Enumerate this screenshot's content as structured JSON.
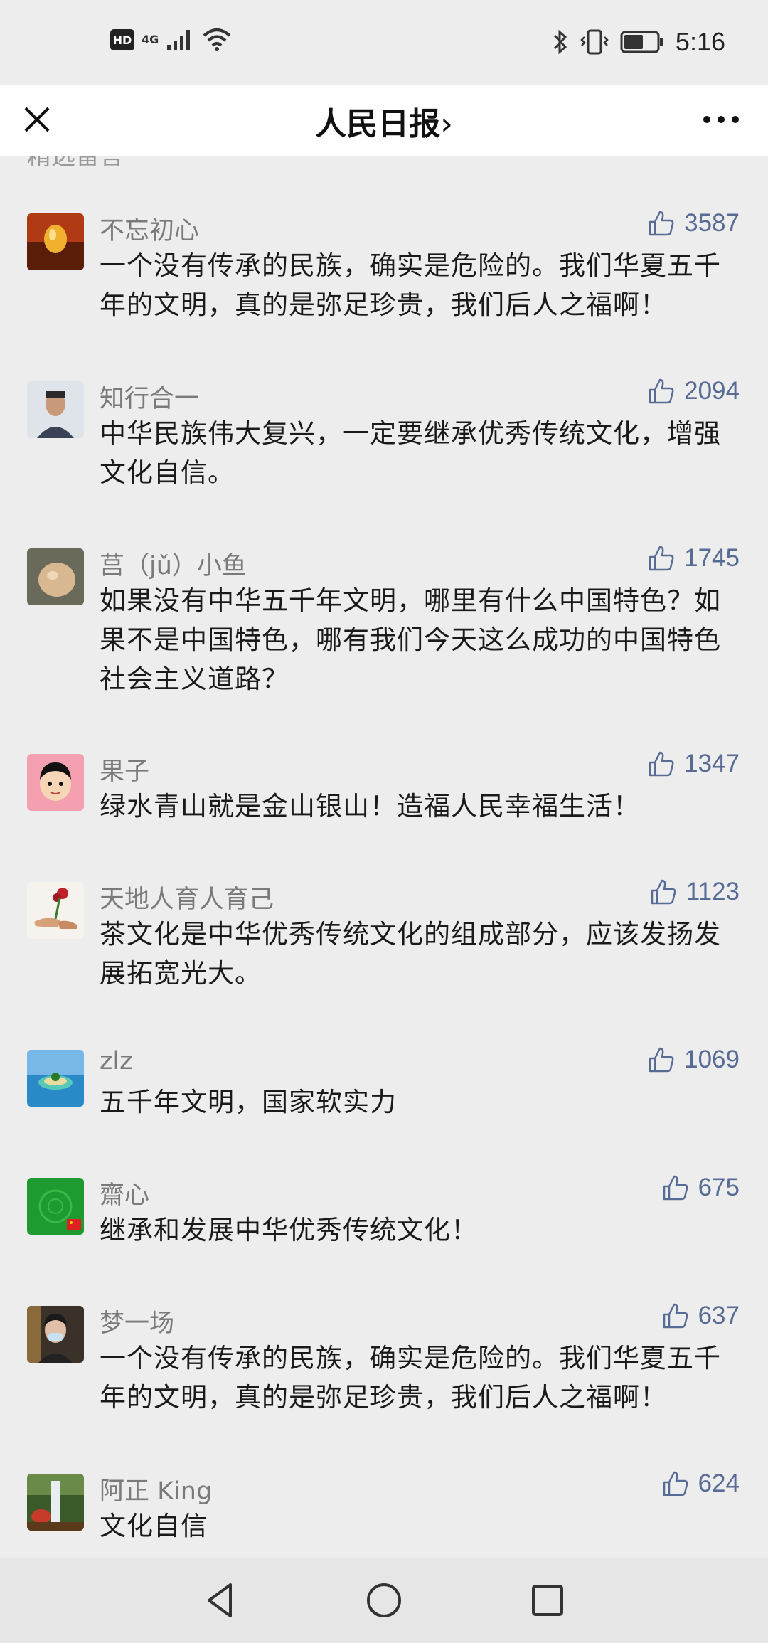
{
  "status_bar": {
    "hd": "HD",
    "network": "4G",
    "time": "5:16"
  },
  "header": {
    "title": "人民日报",
    "chevron": "›"
  },
  "section_label": "精选留言",
  "comments": [
    {
      "author": "不忘初心",
      "likes": "3587",
      "text": "一个没有传承的民族，确实是危险的。我们华夏五千年的文明，真的是弥足珍贵，我们后人之福啊！"
    },
    {
      "author": "知行合一",
      "likes": "2094",
      "text": "中华民族伟大复兴，一定要继承优秀传统文化，增强文化自信。"
    },
    {
      "author": "莒（jǔ）小鱼",
      "likes": "1745",
      "text": "如果没有中华五千年文明，哪里有什么中国特色？如果不是中国特色，哪有我们今天这么成功的中国特色社会主义道路？"
    },
    {
      "author": "果子",
      "likes": "1347",
      "text": "绿水青山就是金山银山！造福人民幸福生活！"
    },
    {
      "author": "天地人育人育己",
      "likes": "1123",
      "text": "茶文化是中华优秀传统文化的组成部分，应该发扬发展拓宽光大。"
    },
    {
      "author": "zlz",
      "likes": "1069",
      "text": "五千年文明，国家软实力"
    },
    {
      "author": "齋心",
      "likes": "675",
      "text": "继承和发展中华优秀传统文化！"
    },
    {
      "author": "梦一场",
      "likes": "637",
      "text": "一个没有传承的民族，确实是危险的。我们华夏五千年的文明，真的是弥足珍贵，我们后人之福啊！"
    },
    {
      "author": "阿正 King",
      "likes": "624",
      "text": "文化自信"
    }
  ],
  "icons": {
    "close": "close-icon",
    "more": "more-dots-icon",
    "like": "thumbs-up-icon",
    "back": "nav-back-icon",
    "home": "nav-home-icon",
    "recents": "nav-recents-icon"
  },
  "colors": {
    "like_count": "#576b95",
    "author": "#7a7a7a",
    "background": "#ededed"
  }
}
